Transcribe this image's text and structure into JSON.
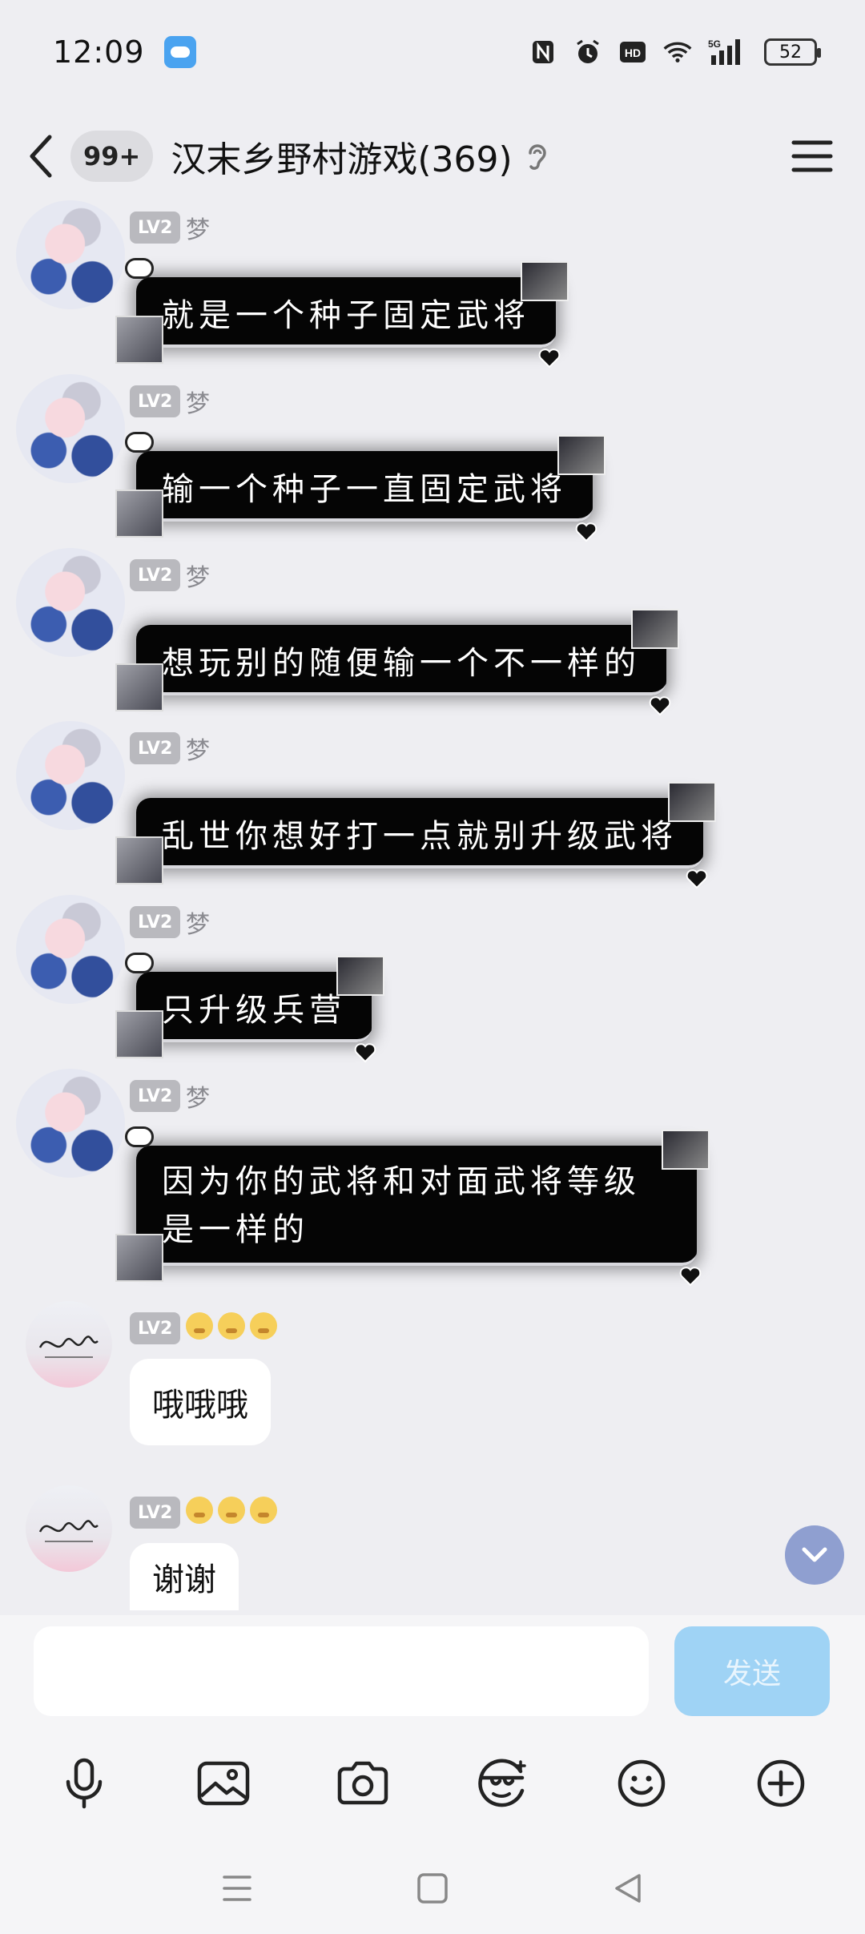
{
  "status_bar": {
    "time": "12:09",
    "battery": "52",
    "network": "5G"
  },
  "header": {
    "unread_count": "99+",
    "title": "汉末乡野村游戏(369)"
  },
  "messages": [
    {
      "level": "LV2",
      "nickname": "梦",
      "text": "就是一个种子固定武将"
    },
    {
      "level": "LV2",
      "nickname": "梦",
      "text": "输一个种子一直固定武将"
    },
    {
      "level": "LV2",
      "nickname": "梦",
      "text": "想玩别的随便输一个不一样的"
    },
    {
      "level": "LV2",
      "nickname": "梦",
      "text": "乱世你想好打一点就别升级武将"
    },
    {
      "level": "LV2",
      "nickname": "梦",
      "text": "只升级兵营"
    },
    {
      "level": "LV2",
      "nickname": "梦",
      "text": "因为你的武将和对面武将等级是一样的"
    },
    {
      "level": "LV2",
      "nickname": "",
      "text": "哦哦哦"
    },
    {
      "level": "LV2",
      "nickname": "",
      "text": "谢谢"
    }
  ],
  "input": {
    "value": "",
    "placeholder": "",
    "send_label": "发送"
  },
  "colors": {
    "background": "#eeeef2",
    "send_button": "#9fd3f5",
    "level_badge": "#b9b9be",
    "scroll_button": "#8f9fd0"
  },
  "toolbar_icons": [
    "mic-icon",
    "image-icon",
    "camera-icon",
    "sticker-face-icon",
    "emoji-icon",
    "plus-icon"
  ]
}
